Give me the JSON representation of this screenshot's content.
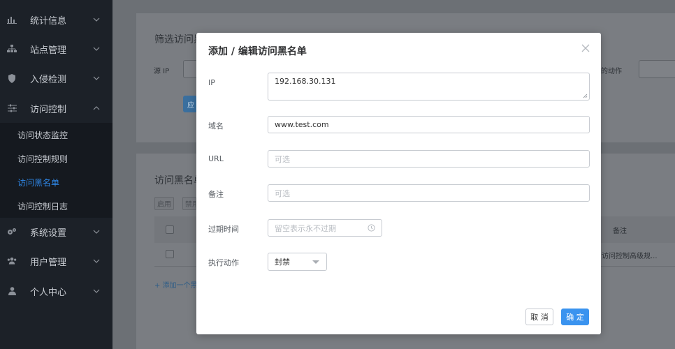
{
  "sidebar": {
    "items": [
      {
        "label": "统计信息",
        "icon": "bar-chart-icon"
      },
      {
        "label": "站点管理",
        "icon": "sitemap-icon"
      },
      {
        "label": "入侵检测",
        "icon": "shield-icon"
      },
      {
        "label": "访问控制",
        "icon": "sliders-icon"
      },
      {
        "label": "系统设置",
        "icon": "gears-icon"
      },
      {
        "label": "用户管理",
        "icon": "users-icon"
      },
      {
        "label": "个人中心",
        "icon": "user-icon"
      }
    ],
    "sub_items": [
      "访问状态监控",
      "访问控制规则",
      "访问黑名单",
      "访问控制日志"
    ],
    "active_sub": "访问黑名单"
  },
  "background": {
    "filter_title": "筛选访问黑",
    "source_ip_label": "源 IP",
    "action_label_partial": "的动作",
    "apply_button_partial": "应",
    "list_title": "访问黑名单",
    "tag_enable": "启用",
    "tag_disable": "禁用",
    "col_remark": "备注",
    "row_remark": "访问控制高级规...",
    "add_link": "+ 添加一个黑"
  },
  "modal": {
    "title": "添加 / 编辑访问黑名单",
    "fields": {
      "ip": {
        "label": "IP",
        "value": "192.168.30.131"
      },
      "domain": {
        "label": "域名",
        "value": "www.test.com"
      },
      "url": {
        "label": "URL",
        "placeholder": "可选"
      },
      "remark": {
        "label": "备注",
        "placeholder": "可选"
      },
      "expire": {
        "label": "过期时间",
        "placeholder": "留空表示永不过期"
      },
      "action": {
        "label": "执行动作",
        "value": "封禁"
      }
    },
    "cancel_label": "取 消",
    "ok_label": "确 定"
  },
  "colors": {
    "accent": "#3a93ef",
    "sidebar_bg": "#1c2128",
    "active_link": "#2f88e8"
  }
}
